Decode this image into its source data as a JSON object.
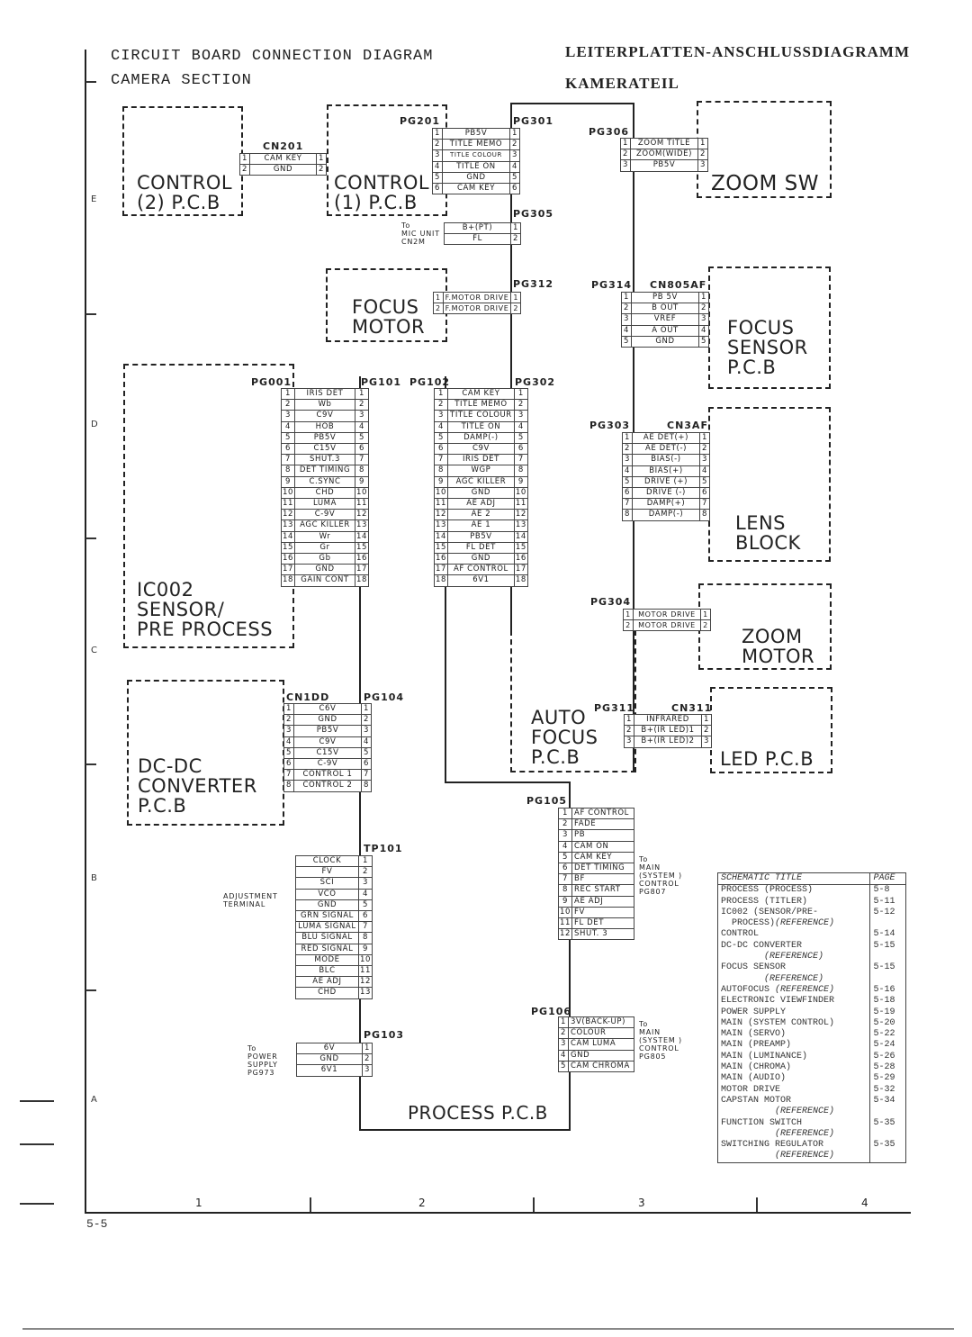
{
  "header": {
    "title_en": "CIRCUIT BOARD CONNECTION DIAGRAM",
    "subtitle_en": "CAMERA SECTION",
    "title_de": "LEITERPLATTEN-ANSCHLUSSDIAGRAMM",
    "subtitle_de": "KAMERATEIL"
  },
  "boards": {
    "control2": [
      "CONTROL",
      "(2) P.C.B"
    ],
    "control1": [
      "CONTROL",
      "(1) P.C.B"
    ],
    "zoom_sw": [
      "ZOOM  SW"
    ],
    "focus_motor": [
      "FOCUS",
      "MOTOR"
    ],
    "focus_sensor": [
      "FOCUS",
      "SENSOR",
      "P.C.B"
    ],
    "ic002": [
      "IC002",
      "SENSOR/",
      "PRE PROCESS"
    ],
    "lens_block": [
      "LENS",
      "BLOCK"
    ],
    "zoom_motor": [
      "ZOOM",
      "MOTOR"
    ],
    "dcdc": [
      "DC-DC",
      "CONVERTER",
      "P.C.B"
    ],
    "auto_focus": [
      "AUTO",
      "FOCUS",
      "P.C.B"
    ],
    "led": [
      "LED  P.C.B"
    ],
    "process": [
      "PROCESS P.C.B"
    ]
  },
  "connectors": {
    "cn201": {
      "name": "CN201",
      "pins": [
        "CAM  KEY",
        "GND"
      ]
    },
    "pg201": {
      "name": "PG201",
      "pins": [
        "PB5V",
        "TITLE MEMO",
        "TITLE COLOUR",
        "TITLE  ON",
        "GND",
        "CAM  KEY"
      ]
    },
    "pg301": {
      "name": "PG301"
    },
    "pg305": {
      "name": "PG305",
      "pins": [
        "B+(PT)",
        "FL"
      ],
      "note": [
        "To",
        "MIC UNIT",
        "CN2M"
      ]
    },
    "pg306": {
      "name": "PG306",
      "pins": [
        "ZOOM TITLE",
        "ZOOM(WIDE)",
        "PB5V"
      ]
    },
    "pg312": {
      "name": "PG312",
      "pins": [
        "F.MOTOR  DRIVE",
        "F.MOTOR DRIVE"
      ]
    },
    "pg314": {
      "name": "PG314"
    },
    "cn805af": {
      "name": "CN805AF",
      "pins": [
        "PB 5V",
        "B  OUT",
        "VREF",
        "A  OUT",
        "GND"
      ]
    },
    "pg001": {
      "name": "PG001",
      "pins": [
        "IRIS  DET",
        "Wb",
        "C9V",
        "HOB",
        "PB5V",
        "C15V",
        "SHUT.3",
        "DET  TIMING",
        "C.SYNC",
        "CHD",
        "LUMA",
        "C-9V",
        "AGC  KILLER",
        "Wr",
        "Gr",
        "Gb",
        "GND",
        "GAIN CONT"
      ]
    },
    "pg101": {
      "name": "PG101"
    },
    "pg102": {
      "name": "PG102",
      "pins": [
        "CAM  KEY",
        "TITLE  MEMO",
        "TITLE COLOUR",
        "TITLE  ON",
        "DAMP(-)",
        "C9V",
        "IRIS  DET",
        "WGP",
        "AGC  KILLER",
        "GND",
        "AE  ADJ",
        "AE 2",
        "AE 1",
        "PB5V",
        "FL  DET",
        "GND",
        "AF  CONTROL",
        "6V1"
      ]
    },
    "pg302": {
      "name": "PG302"
    },
    "pg303": {
      "name": "PG303"
    },
    "cn3af": {
      "name": "CN3AF",
      "pins": [
        "AE  DET(+)",
        "AE  DET(-)",
        "BIAS(-)",
        "BIAS(+)",
        "DRIVE  (+)",
        "DRIVE  (-)",
        "DAMP(+)",
        "DAMP(-)"
      ]
    },
    "pg304": {
      "name": "PG304",
      "pins": [
        "MOTOR DRIVE",
        "MOTOR DRIVE"
      ]
    },
    "cn100": {
      "name": "CN1DD",
      "pins": [
        "C6V",
        "GND",
        "PB5V",
        "C9V",
        "C15V",
        "C-9V",
        "CONTROL 1",
        "CONTROL 2"
      ]
    },
    "pg104": {
      "name": "PG104"
    },
    "pg311": {
      "name": "PG311"
    },
    "cn311": {
      "name": "CN311",
      "pins": [
        "INFRARED",
        "B+(IR  LED)1",
        "B+(IR  LED)2"
      ]
    },
    "tp101": {
      "name": "TP101",
      "pins": [
        "CLOCK",
        "FV",
        "SCI",
        "VCO",
        "GND",
        "GRN SIGNAL",
        "LUMA SIGNAL",
        "BLU SIGNAL",
        "RED SIGNAL",
        "MODE",
        "BLC",
        "AE  ADJ",
        "CHD"
      ],
      "note": [
        "ADJUSTMENT",
        "TERMINAL"
      ]
    },
    "pg103": {
      "name": "PG103",
      "pins": [
        "6V",
        "GND",
        "6V1"
      ],
      "note": [
        "To",
        "POWER",
        "SUPPLY",
        "PG973"
      ]
    },
    "pg105": {
      "name": "PG105",
      "pins": [
        "AF CONTROL",
        "FADE",
        "PB",
        "CAM  ON",
        "CAM  KEY",
        "DET  TIMING",
        "BF",
        "REC  START",
        "AE   ADJ",
        "FV",
        "FL  DET",
        "SHUT. 3"
      ],
      "note": [
        "To",
        "MAIN",
        "(SYSTEM )",
        "CONTROL",
        "PG807"
      ]
    },
    "pg106": {
      "name": "PG106",
      "pins": [
        "3V(BACK-UP)",
        "COLOUR",
        "CAM  LUMA",
        "GND",
        "CAM CHROMA"
      ],
      "note": [
        "To",
        "MAIN",
        "(SYSTEM )",
        "CONTROL",
        "PG805"
      ]
    }
  },
  "index_table": {
    "header": {
      "title": "SCHEMATIC TITLE",
      "page": "PAGE"
    },
    "rows": [
      {
        "title": "PROCESS (PROCESS)",
        "page": "5-8"
      },
      {
        "title": "PROCESS (TITLER)",
        "page": "5-11"
      },
      {
        "title": "IC002 (SENSOR/PRE-",
        "page": "5-12"
      },
      {
        "title": "  PROCESS)",
        "ref": "(REFERENCE)",
        "page": ""
      },
      {
        "title": "CONTROL",
        "page": "5-14"
      },
      {
        "title": "DC-DC CONVERTER",
        "page": "5-15"
      },
      {
        "title": "",
        "ref": "        (REFERENCE)",
        "page": ""
      },
      {
        "title": "FOCUS SENSOR",
        "page": "5-15"
      },
      {
        "title": "",
        "ref": "        (REFERENCE)",
        "page": ""
      },
      {
        "title": "AUTOFOCUS ",
        "ref": "(REFERENCE)",
        "page": "5-16"
      },
      {
        "title": "ELECTRONIC VIEWFINDER",
        "page": "5-18"
      },
      {
        "title": "POWER SUPPLY",
        "page": "5-19"
      },
      {
        "title": "MAIN (SYSTEM CONTROL)",
        "page": "5-20"
      },
      {
        "title": "MAIN (SERVO)",
        "page": "5-22"
      },
      {
        "title": "MAIN (PREAMP)",
        "page": "5-24"
      },
      {
        "title": "MAIN (LUMINANCE)",
        "page": "5-26"
      },
      {
        "title": "MAIN (CHROMA)",
        "page": "5-28"
      },
      {
        "title": "MAIN (AUDIO)",
        "page": "5-29"
      },
      {
        "title": "MOTOR DRIVE",
        "page": "5-32"
      },
      {
        "title": "CAPSTAN MOTOR",
        "page": "5-34"
      },
      {
        "title": "",
        "ref": "          (REFERENCE)",
        "page": ""
      },
      {
        "title": "FUNCTION SWITCH",
        "page": "5-35"
      },
      {
        "title": "",
        "ref": "          (REFERENCE)",
        "page": ""
      },
      {
        "title": "SWITCHING REGULATOR",
        "page": "5-35"
      },
      {
        "title": "",
        "ref": "          (REFERENCE)",
        "page": ""
      }
    ]
  },
  "grid": {
    "rows": [
      "E",
      "D",
      "C",
      "B",
      "A"
    ],
    "cols": [
      "1",
      "2",
      "3",
      "4"
    ]
  },
  "footer": {
    "page_number": "5-5"
  }
}
